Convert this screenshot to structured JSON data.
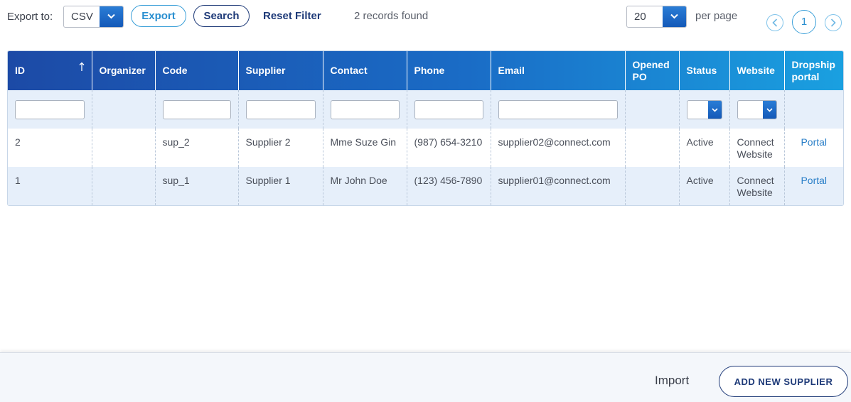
{
  "toolbar": {
    "export_label": "Export to:",
    "export_format": "CSV",
    "export_button": "Export",
    "search_button": "Search",
    "reset_filter": "Reset Filter",
    "records_found": "2 records found",
    "page_size": "20",
    "per_page_label": "per page",
    "current_page": "1"
  },
  "table": {
    "columns": [
      "ID",
      "Organizer",
      "Code",
      "Supplier",
      "Contact",
      "Phone",
      "Email",
      "Opened PO",
      "Status",
      "Website",
      "Dropship portal"
    ],
    "sort": {
      "column": "ID",
      "direction": "ascending"
    },
    "rows": [
      {
        "id": "2",
        "organizer": "",
        "code": "sup_2",
        "supplier": "Supplier 2",
        "contact": "Mme Suze Gin",
        "phone": "(987) 654-3210",
        "email": "supplier02@connect.com",
        "opened_po": "",
        "status": "Active",
        "website": "Connect Website",
        "portal": "Portal"
      },
      {
        "id": "1",
        "organizer": "",
        "code": "sup_1",
        "supplier": "Supplier 1",
        "contact": "Mr John Doe",
        "phone": "(123) 456-7890",
        "email": "supplier01@connect.com",
        "opened_po": "",
        "status": "Active",
        "website": "Connect Website",
        "portal": "Portal"
      }
    ]
  },
  "footer": {
    "import_label": "Import",
    "add_button": "ADD NEW SUPPLIER"
  },
  "colors": {
    "header_gradient_start": "#1c4aa6",
    "header_gradient_end": "#1aa0e0",
    "accent_blue": "#2a8fd0",
    "navy": "#1e3a78",
    "row_alt": "#e6effa"
  },
  "icons": {
    "dropdown": "chevron-down-icon",
    "sort": "arrow-up-icon",
    "prev_page": "chevron-left-icon",
    "next_page": "chevron-right-icon"
  }
}
